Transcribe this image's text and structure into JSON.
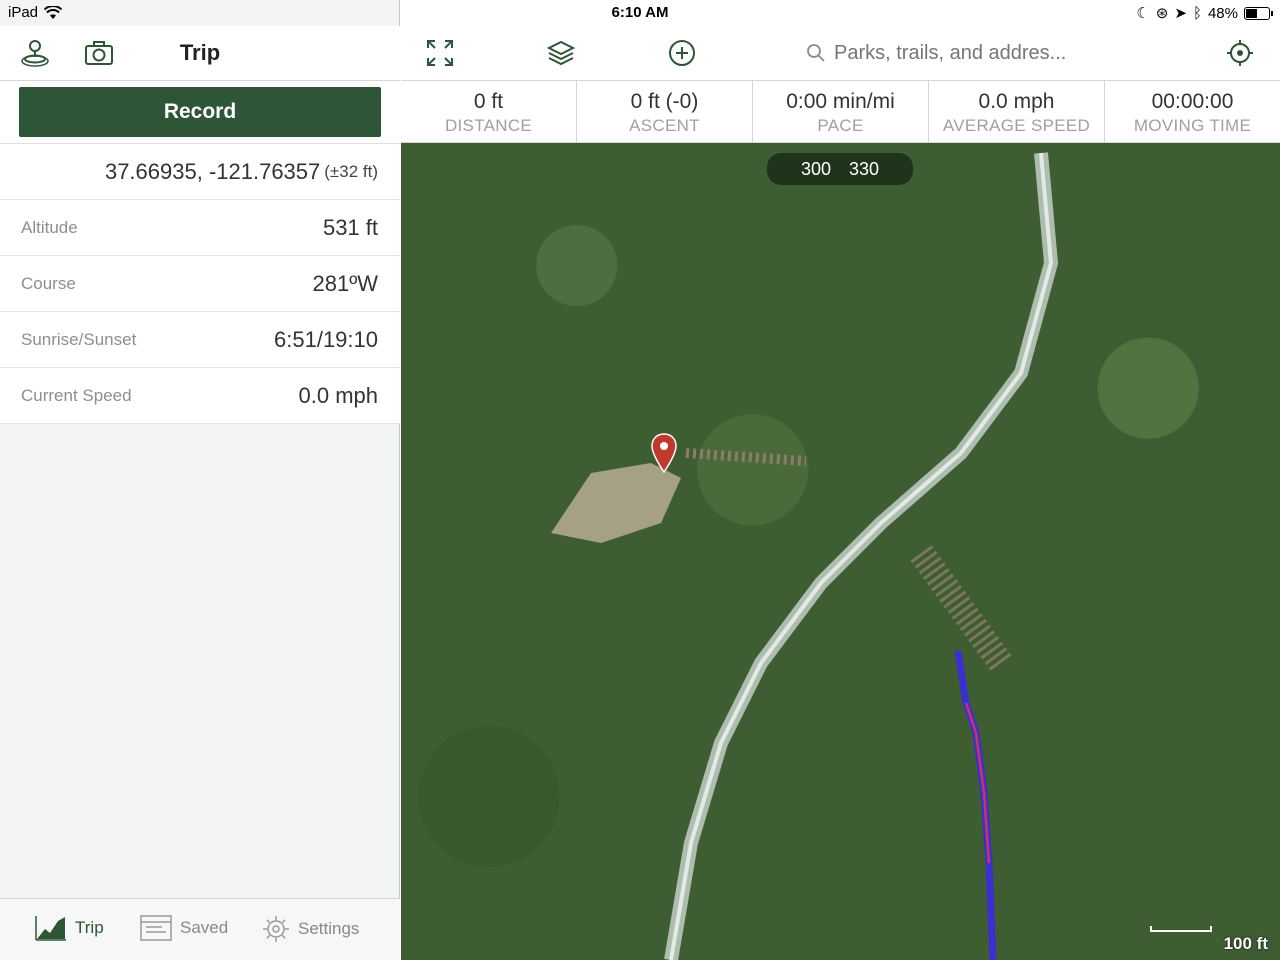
{
  "status_bar": {
    "device": "iPad",
    "time": "6:10 AM",
    "battery": "48%",
    "battery_level": 0.48
  },
  "sidebar": {
    "title": "Trip",
    "record_label": "Record",
    "coordinates": "37.66935, -121.76357",
    "accuracy": "(±32 ft)",
    "rows": [
      {
        "label": "Altitude",
        "value": "531 ft"
      },
      {
        "label": "Course",
        "value": "281ºW"
      },
      {
        "label": "Sunrise/Sunset",
        "value": "6:51/19:10"
      },
      {
        "label": "Current Speed",
        "value": "0.0 mph"
      }
    ]
  },
  "tabs": [
    {
      "label": "Trip",
      "icon": "chart-icon",
      "active": true
    },
    {
      "label": "Saved",
      "icon": "document-icon",
      "active": false
    },
    {
      "label": "Settings",
      "icon": "gear-icon",
      "active": false
    }
  ],
  "search": {
    "placeholder": "Parks, trails, and addres..."
  },
  "stats": [
    {
      "value": "0 ft",
      "label": "DISTANCE"
    },
    {
      "value": "0 ft (-0)",
      "label": "ASCENT"
    },
    {
      "value": "0:00 min/mi",
      "label": "PACE"
    },
    {
      "value": "0.0 mph",
      "label": "AVERAGE SPEED"
    },
    {
      "value": "00:00:00",
      "label": "MOVING TIME"
    }
  ],
  "map": {
    "compass_left": "300",
    "compass_right": "330",
    "scale": "100 ft"
  },
  "colors": {
    "accent": "#2e5535",
    "pin": "#c0392b",
    "track": "#3a2fd0"
  }
}
